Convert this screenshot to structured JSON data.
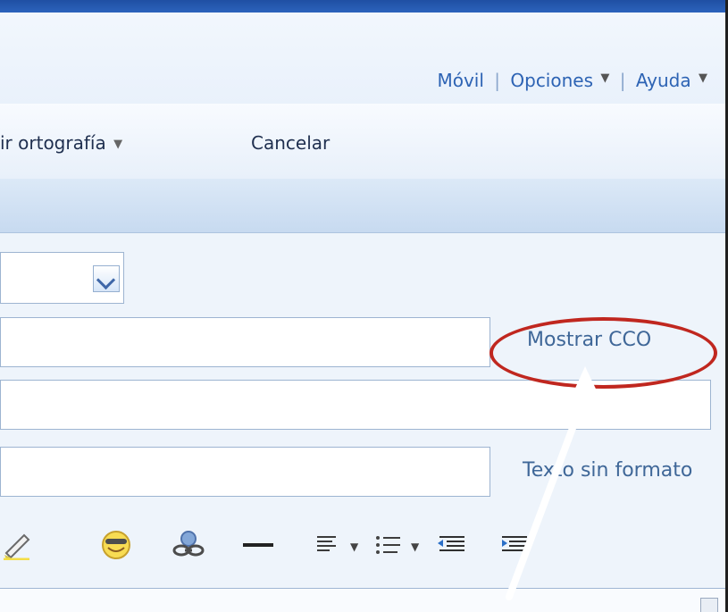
{
  "topLinks": {
    "mobile": "Móvil",
    "separator1": "|",
    "options": "Opciones",
    "separator2": "|",
    "help": "Ayuda"
  },
  "toolbar": {
    "spellcheck_label": "ir ortografía",
    "cancel_label": "Cancelar"
  },
  "compose": {
    "show_bcc": "Mostrar CCO",
    "plain_text": "Texto sin formato"
  },
  "colors": {
    "link": "#2d63b4",
    "highlight": "#c0271f",
    "window_bg": "#eef4fb"
  },
  "icons": {
    "cancel": "cancel-document-icon",
    "mail_view": "mail-view-icon",
    "chat_view": "chat-view-icon",
    "highlighter": "highlighter-icon",
    "emoticon": "emoticon-icon",
    "insert_link": "insert-link-icon",
    "horizontal_rule": "horizontal-rule-icon",
    "align": "align-icon",
    "bullets": "bullets-icon",
    "decrease_indent": "decrease-indent-icon",
    "increase_indent": "increase-indent-icon"
  }
}
